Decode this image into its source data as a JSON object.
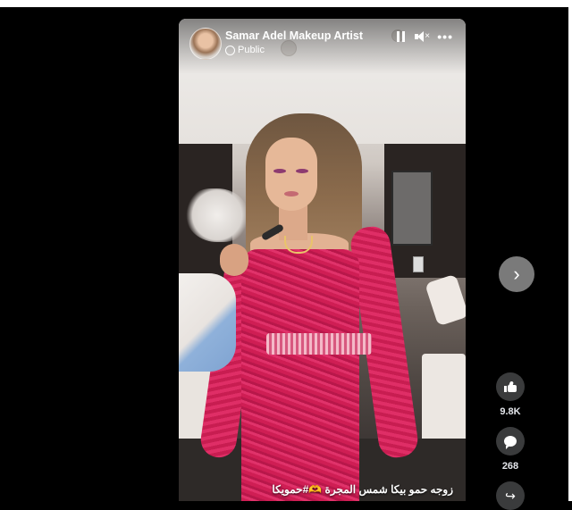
{
  "post": {
    "page_name": "Samar Adel Makeup Artist",
    "privacy": "Public",
    "caption": "زوجه حمو بيكا شمس المجرة 🫶#حمويكا"
  },
  "controls": {
    "pause_icon": "pause-icon",
    "mute_icon": "volume-muted-icon",
    "more_icon": "more-dots-icon",
    "more_label": "•••"
  },
  "side": {
    "next_label": "›",
    "likes": "9.8K",
    "comments": "268",
    "share_label": "↪"
  },
  "colors": {
    "background": "#000000",
    "button_bg": "#3a3b3c",
    "next_button_bg": "#7a7a7a"
  }
}
